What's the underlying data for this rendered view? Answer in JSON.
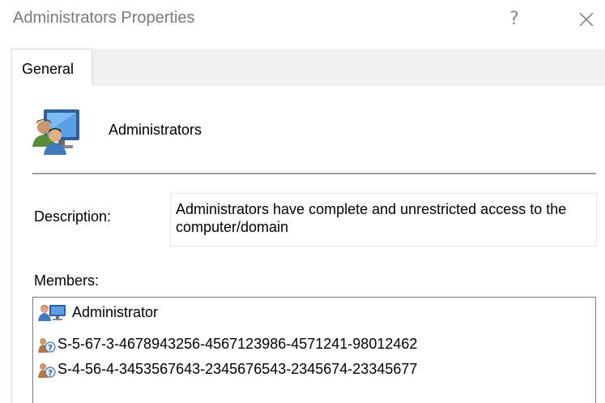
{
  "window": {
    "title": "Administrators Properties",
    "help_label": "?",
    "close_icon": "close-icon"
  },
  "tabs": [
    {
      "label": "General",
      "selected": true
    }
  ],
  "group": {
    "name": "Administrators",
    "icon": "user-group-icon"
  },
  "description": {
    "label": "Description:",
    "value": "Administrators have complete and unrestricted access to the computer/domain"
  },
  "members": {
    "label": "Members:",
    "items": [
      {
        "name": "Administrator",
        "icon": "local-user-icon"
      },
      {
        "name": "S-5-67-3-4678943256-4567123986-4571241-98012462",
        "icon": "unknown-account-icon"
      },
      {
        "name": "S-4-56-4-3453567643-2345676543-2345674-23345677",
        "icon": "unknown-account-icon"
      }
    ]
  },
  "colors": {
    "title_text": "#7a7a7a",
    "tabstrip_bg": "#f0f0f0",
    "divider": "#a0a0a0",
    "list_border": "#7a7a7a"
  }
}
